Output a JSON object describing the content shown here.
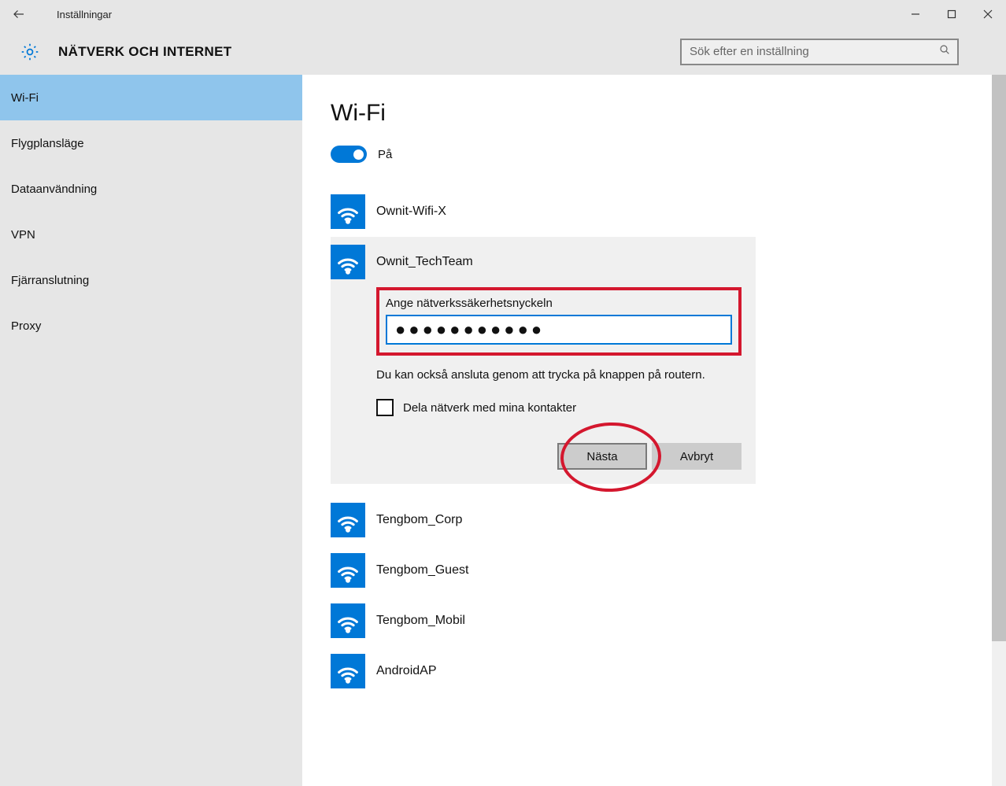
{
  "window": {
    "title": "Inställningar"
  },
  "header": {
    "category": "NÄTVERK OCH INTERNET",
    "search_placeholder": "Sök efter en inställning"
  },
  "sidebar": {
    "items": [
      {
        "label": "Wi-Fi",
        "active": true
      },
      {
        "label": "Flygplansläge",
        "active": false
      },
      {
        "label": "Dataanvändning",
        "active": false
      },
      {
        "label": "VPN",
        "active": false
      },
      {
        "label": "Fjärranslutning",
        "active": false
      },
      {
        "label": "Proxy",
        "active": false
      }
    ]
  },
  "main": {
    "page_title": "Wi-Fi",
    "toggle": {
      "state": "on",
      "label": "På"
    },
    "networks_before": [
      {
        "name": "Ownit-Wifi-X"
      }
    ],
    "selected_network": {
      "name": "Ownit_TechTeam",
      "security_label": "Ange nätverkssäkerhetsnyckeln",
      "password_value": "●●●●●●●●●●●",
      "hint": "Du kan också ansluta genom att trycka på knappen på routern.",
      "share_label": "Dela nätverk med mina kontakter",
      "next_label": "Nästa",
      "cancel_label": "Avbryt"
    },
    "networks_after": [
      {
        "name": "Tengbom_Corp"
      },
      {
        "name": "Tengbom_Guest"
      },
      {
        "name": "Tengbom_Mobil"
      },
      {
        "name": "AndroidAP"
      }
    ]
  }
}
